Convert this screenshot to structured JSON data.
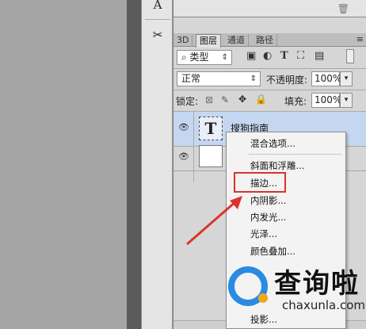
{
  "tools": {
    "text_icon": "A",
    "scissors_icon": "✂"
  },
  "tabs": {
    "t3d": "3D",
    "layers": "图层",
    "channels": "通道",
    "paths": "路径",
    "menu_icon": "≡"
  },
  "filter": {
    "kind_label": "类型",
    "icons": [
      "image-filter-icon",
      "adjust-filter-icon",
      "type-filter-icon",
      "shape-filter-icon",
      "smartobject-filter-icon"
    ]
  },
  "blend": {
    "mode": "正常",
    "opacity_label": "不透明度:",
    "opacity_value": "100%"
  },
  "lock": {
    "label": "锁定:",
    "fill_label": "填充:",
    "fill_value": "100%"
  },
  "layers": [
    {
      "name": "搜狗指南",
      "type": "text",
      "thumb_glyph": "T"
    },
    {
      "name": "",
      "type": "background"
    }
  ],
  "context_menu": {
    "items": [
      "混合选项...",
      "斜面和浮雕...",
      "描边...",
      "内阴影...",
      "内发光...",
      "光泽...",
      "颜色叠加...",
      "投影..."
    ],
    "highlighted": "描边..."
  },
  "watermark": {
    "title": "查询啦",
    "url": "chaxunla.com"
  },
  "colors": {
    "highlight": "#d9342b",
    "selected_layer": "#c5d7f0",
    "watermark_blue": "#2a8be2"
  }
}
